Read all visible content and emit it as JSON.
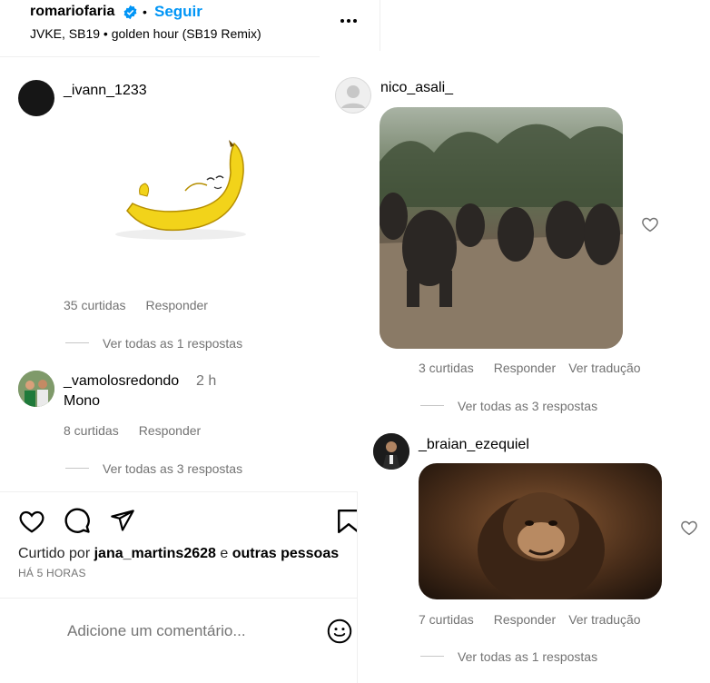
{
  "header": {
    "username": "romariofaria",
    "dot": "•",
    "follow_label": "Seguir",
    "audio": "JVKE, SB19 • golden hour (SB19 Remix)",
    "more_icon": "more-horizontal-icon"
  },
  "comments_left": [
    {
      "username": "_ivann_1233",
      "likes": "35 curtidas",
      "reply": "Responder",
      "view_replies": "Ver todas as 1 respostas"
    },
    {
      "username": "_vamolosredondo",
      "time": "2 h",
      "text": "Mono",
      "likes": "8 curtidas",
      "reply": "Responder",
      "view_replies": "Ver todas as 3 respostas"
    }
  ],
  "comments_right": [
    {
      "username": "nico_asali_",
      "likes": "3 curtidas",
      "reply": "Responder",
      "translate": "Ver tradução",
      "view_replies": "Ver todas as 3 respostas"
    },
    {
      "username": "_braian_ezequiel",
      "likes": "7 curtidas",
      "reply": "Responder",
      "translate": "Ver tradução",
      "view_replies": "Ver todas as 1 respostas"
    }
  ],
  "actions": {
    "liked_prefix": "Curtido por",
    "liked_user": "jana_martins2628",
    "liked_and": "e",
    "liked_others": "outras pessoas",
    "time": "HÁ 5 HORAS"
  },
  "comment_box": {
    "placeholder": "Adicione um comentário..."
  },
  "colors": {
    "link_blue": "#0095f6",
    "verified_blue": "#0095f6",
    "muted": "#737373"
  }
}
